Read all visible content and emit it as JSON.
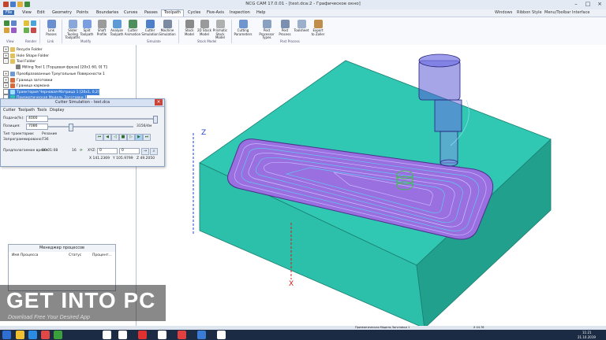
{
  "window": {
    "title": "NCG CAM 17.0.01 - [test.dca:2 - Графическое окно]"
  },
  "menu": {
    "tabs": [
      "File",
      "View",
      "Edit",
      "Geometry",
      "Points",
      "Boundaries",
      "Curves",
      "Passes",
      "Toolpath",
      "Cycles",
      "Five-Axis",
      "Inspection",
      "Help"
    ],
    "active": "Toolpath",
    "right": [
      "Windows",
      "Ribbon Style",
      "Menu/Toolbar Interface"
    ]
  },
  "ribbon": {
    "buttons": [
      {
        "label": "Link\nPasses",
        "icon": "link-passes-icon"
      },
      {
        "label": "Slider\nTooling Toolpaths",
        "icon": "slider-icon"
      },
      {
        "label": "Split\nToolpath",
        "icon": "split-icon"
      },
      {
        "label": "Shaft\nProfile",
        "icon": "shaft-icon"
      },
      {
        "label": "Analyse\nToolpath",
        "icon": "analyse-icon"
      },
      {
        "label": "Cutter\nAnimation",
        "icon": "cutter-animation-icon"
      },
      {
        "label": "Cutter\nSimulation",
        "icon": "cutter-simulation-icon"
      },
      {
        "label": "Machine\nSimulation",
        "icon": "machine-simulation-icon"
      },
      {
        "label": "Stock\nModel",
        "icon": "stock-model-icon"
      },
      {
        "label": "2D Stock\nModel",
        "icon": "stock-2d-icon"
      },
      {
        "label": "Prismatic\nStock Model",
        "icon": "prismatic-icon"
      },
      {
        "label": "Cutting\nParameters",
        "icon": "cutting-params-icon"
      },
      {
        "label": "Post Processor\nTypes",
        "icon": "post-types-icon"
      },
      {
        "label": "Post\nProcess",
        "icon": "post-process-icon"
      },
      {
        "label": "Toolsheet",
        "icon": "toolsheet-icon"
      },
      {
        "label": "Export\nto Zoller",
        "icon": "export-zoller-icon"
      }
    ],
    "groups": [
      "View",
      "Render",
      "Link",
      "Modify",
      "Simulate",
      "Stock Model",
      "Post Process"
    ]
  },
  "tree": {
    "items": [
      {
        "label": "Recycle Folder",
        "sel": false
      },
      {
        "label": "Hole Shape Folder",
        "sel": false
      },
      {
        "label": "Tool Folder",
        "sel": false
      },
      {
        "label": "Milling Tool 1 [Торцевая фреза] [20x1 60, 0] T1",
        "sel": false
      },
      {
        "label": "Преобразованные Треугольные Поверхности 1",
        "sel": false
      },
      {
        "label": "Граница заготовки",
        "sel": false
      },
      {
        "label": "Граница кармана",
        "sel": false
      },
      {
        "label": "Траектория Черновая-Матрица 1 [20x1, 0,2]",
        "sel": true
      },
      {
        "label": "Призматическая Модель Заготовки 1",
        "sel": true
      }
    ]
  },
  "sim": {
    "title": "Cutter Simulation - test.dca",
    "menu": [
      "Cutter",
      "Toolpath",
      "Tools",
      "Display"
    ],
    "feed_label": "Подача(%):",
    "feed_value": "4000",
    "pos_label": "Позиция:",
    "pos_value": "7086",
    "pos_total": "3156/4м",
    "type_label": "Тип траектории:",
    "type_value": "Резание",
    "lines_label": "Запрограммировано:",
    "lines_value": "736",
    "time_label": "Предполагаемое время:",
    "time_value": "00:01:08",
    "time_num": "16",
    "xyz_label": "XYZ:",
    "xyz_in1": "0",
    "xyz_in2": "0",
    "coords": [
      "X 141.2369",
      "Y 105.9799",
      "Z 49.2050"
    ]
  },
  "proc": {
    "title": "Менеджер процессов",
    "headers": [
      "Имя Процесса",
      "Статус",
      "Процент..."
    ]
  },
  "axes": {
    "z": "Z",
    "x": "X"
  },
  "watermark": {
    "title": "GET INTO PC",
    "subtitle": "Download Free Your Desired App"
  },
  "statusbar": {
    "text": "Призматическая Модель Заготовки 1",
    "right": "X 44.76"
  },
  "taskbar": {
    "time": "11:21",
    "date": "21.10.2019"
  },
  "colors": {
    "stock": "#2ec7b2",
    "stock_side": "#26a896",
    "tool": "#5b5bd6",
    "toolpath": "#8a4fd8",
    "accent": "#3d7fd8"
  }
}
